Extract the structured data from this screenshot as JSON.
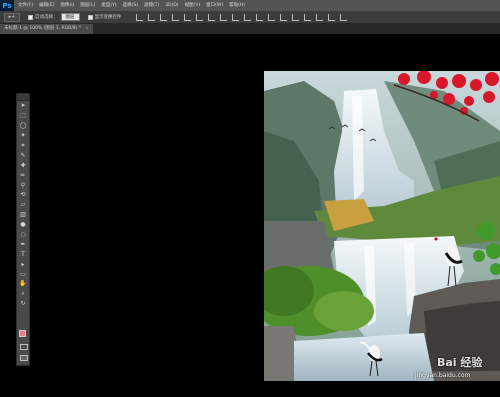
{
  "app": {
    "logo": "Ps"
  },
  "menu": [
    "文件(F)",
    "编辑(E)",
    "图像(I)",
    "图层(L)",
    "类型(Y)",
    "选择(S)",
    "滤镜(T)",
    "3D(D)",
    "视图(V)",
    "窗口(W)",
    "帮助(H)"
  ],
  "options": {
    "tool_preset": "▸+",
    "auto_select_label": "自动选择：",
    "auto_select_value": "图层",
    "show_transform_label": "显示变换控件"
  },
  "document": {
    "tab_label": "未标题-1 @ 100% (图层 1, RGB/8) *",
    "close": "×"
  },
  "tools": [
    "move-icon",
    "marquee-icon",
    "lasso-icon",
    "quick-select-icon",
    "crop-icon",
    "eyedropper-icon",
    "healing-icon",
    "brush-icon",
    "clone-stamp-icon",
    "history-brush-icon",
    "eraser-icon",
    "gradient-icon",
    "blur-icon",
    "dodge-icon",
    "pen-icon",
    "type-icon",
    "path-select-icon",
    "shape-icon",
    "hand-icon",
    "zoom-icon",
    "rotate-icon"
  ],
  "tool_glyphs": [
    "➤",
    "⬚",
    "◯",
    "✦",
    "⌗",
    "✎",
    "✚",
    "✏",
    "⚲",
    "⟲",
    "▱",
    "▥",
    "●",
    "○",
    "✒",
    "T",
    "▸",
    "▭",
    "✋",
    "⌕",
    "↻"
  ],
  "colors": {
    "foreground": "#e87f8a",
    "background": "#ffffff",
    "menubar": "#535353",
    "optionsbar": "#3c3c3c",
    "panel": "#4a4a4a"
  },
  "watermark": {
    "main": "Bai 经验",
    "url": "jingyan.baidu.com"
  }
}
